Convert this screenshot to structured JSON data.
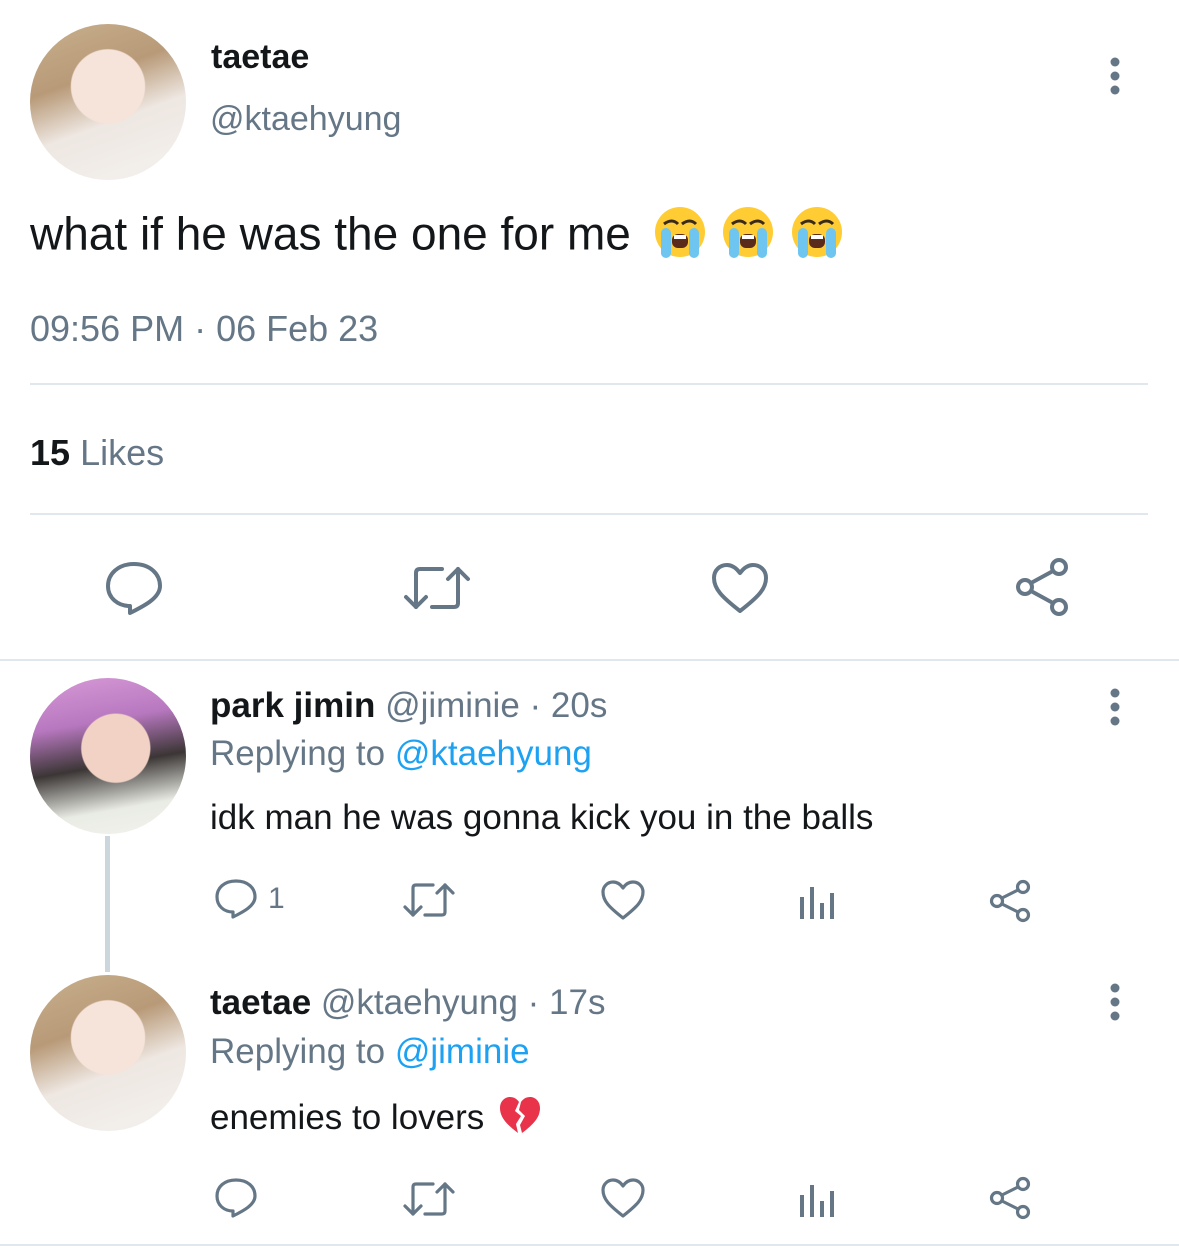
{
  "main_tweet": {
    "display_name": "taetae",
    "handle": "@ktaehyung",
    "text": "what if he was the one for me",
    "emojis": [
      "loudly-crying-face",
      "loudly-crying-face",
      "loudly-crying-face"
    ],
    "timestamp": "09:56 PM · 06 Feb 23",
    "likes_count": "15",
    "likes_label": "Likes"
  },
  "replies": [
    {
      "display_name": "park jimin",
      "handle_time": "@jiminie · 20s",
      "replying_prefix": "Replying to",
      "replying_to": "@ktaehyung",
      "text": "idk man he was gonna kick you in the balls",
      "reply_count": "1"
    },
    {
      "display_name": "taetae",
      "handle_time": "@ktaehyung · 17s",
      "replying_prefix": "Replying to",
      "replying_to": "@jiminie",
      "text": "enemies to lovers",
      "emoji": "broken-heart",
      "reply_count": ""
    }
  ],
  "colors": {
    "text": "#14171a",
    "secondary": "#657786",
    "link": "#1da1f2",
    "divider": "#e1e8ed",
    "icon": "#657786"
  }
}
